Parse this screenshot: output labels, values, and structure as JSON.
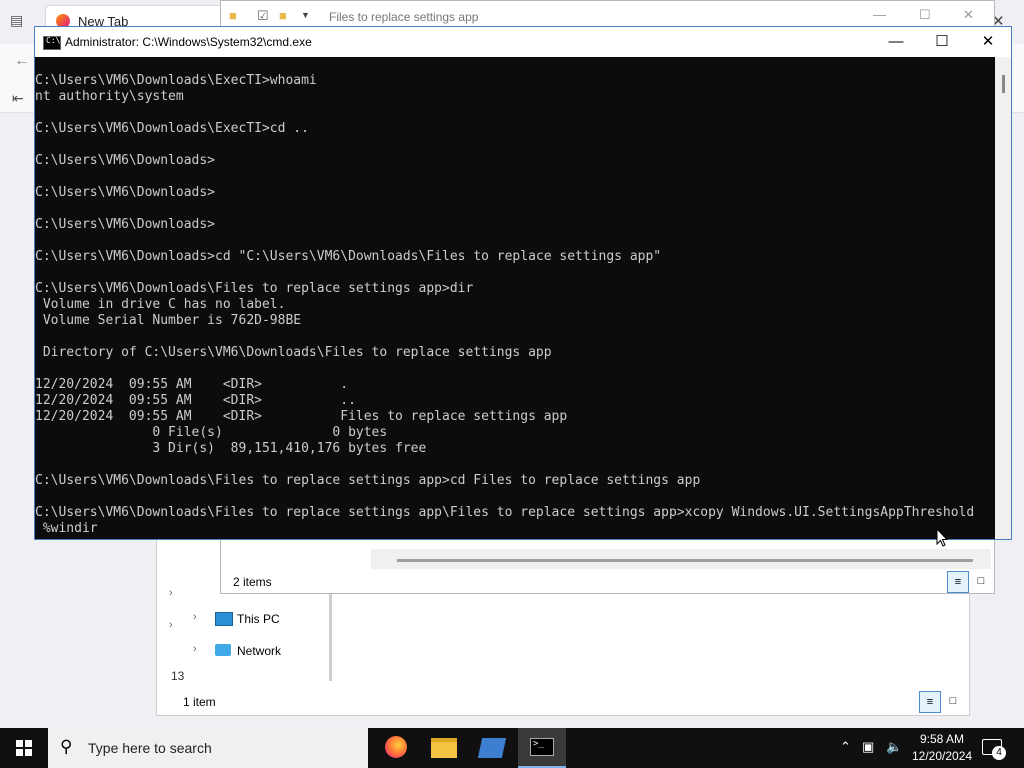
{
  "browser": {
    "tab_title": "New Tab"
  },
  "explorer_back": {
    "nav_items": [
      {
        "label": "This PC",
        "icon": "pc-icon"
      },
      {
        "label": "Network",
        "icon": "network-icon"
      }
    ],
    "status": "1 item",
    "partial_count": "13"
  },
  "explorer_front": {
    "title": "Files to replace settings app",
    "status": "2 items"
  },
  "cmd": {
    "title": "Administrator: C:\\Windows\\System32\\cmd.exe",
    "minimize": "—",
    "maximize": "☐",
    "close": "✕",
    "output": "C:\\Users\\VM6\\Downloads\\ExecTI>whoami\nnt authority\\system\n\nC:\\Users\\VM6\\Downloads\\ExecTI>cd ..\n\nC:\\Users\\VM6\\Downloads>\n\nC:\\Users\\VM6\\Downloads>\n\nC:\\Users\\VM6\\Downloads>\n\nC:\\Users\\VM6\\Downloads>cd \"C:\\Users\\VM6\\Downloads\\Files to replace settings app\"\n\nC:\\Users\\VM6\\Downloads\\Files to replace settings app>dir\n Volume in drive C has no label.\n Volume Serial Number is 762D-98BE\n\n Directory of C:\\Users\\VM6\\Downloads\\Files to replace settings app\n\n12/20/2024  09:55 AM    <DIR>          .\n12/20/2024  09:55 AM    <DIR>          ..\n12/20/2024  09:55 AM    <DIR>          Files to replace settings app\n               0 File(s)              0 bytes\n               3 Dir(s)  89,151,410,176 bytes free\n\nC:\\Users\\VM6\\Downloads\\Files to replace settings app>cd Files to replace settings app\n\nC:\\Users\\VM6\\Downloads\\Files to replace settings app\\Files to replace settings app>xcopy Windows.UI.SettingsAppThreshold\n %windir"
  },
  "taskbar": {
    "search_placeholder": "Type here to search",
    "time": "9:58 AM",
    "date": "12/20/2024",
    "notification_count": "4",
    "apps": [
      {
        "name": "firefox",
        "icon": "firefox-icon"
      },
      {
        "name": "file-explorer",
        "icon": "folder-icon"
      },
      {
        "name": "settings-app",
        "icon": "app-icon"
      },
      {
        "name": "command-prompt",
        "icon": "cmd-icon",
        "active": true
      }
    ]
  }
}
